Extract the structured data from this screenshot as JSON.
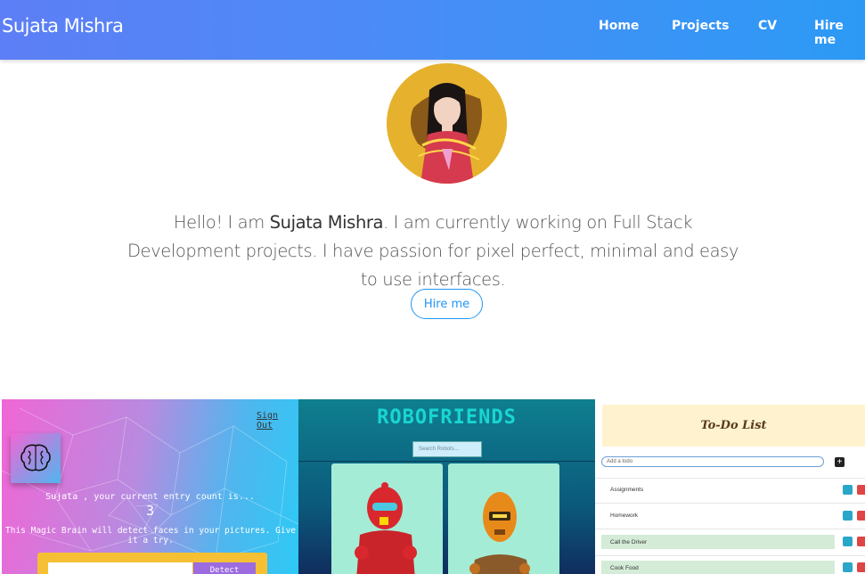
{
  "navbar": {
    "brand": "Sujata Mishra",
    "links": [
      "Home",
      "Projects",
      "CV",
      "Hire me"
    ]
  },
  "hero": {
    "greeting": "Hello! I am ",
    "name": "Sujata Mishra",
    "intro_rest": ". I am currently working on Full Stack Development projects. I have passion for pixel perfect, minimal and easy to use interfaces.",
    "hire_button": "Hire me"
  },
  "projects": {
    "face_detect": {
      "sign_out": "Sign Out",
      "count_text": "Sujata , your current entry count is...",
      "count": "3",
      "magic_text": "This Magic Brain will detect faces in your pictures. Give it a try.",
      "detect_button": "Detect"
    },
    "robofriends": {
      "title": "ROBOFRIENDS",
      "search_placeholder": "Search Robots..."
    },
    "todo": {
      "title": "To-Do List",
      "input_placeholder": "Add a todo",
      "add_icon": "+",
      "items": [
        "Assignments",
        "Homework",
        "Call the Driver",
        "Cook Food"
      ]
    }
  },
  "colors": {
    "nav_gradient_start": "#5d7ef6",
    "nav_gradient_end": "#2c9af5",
    "accent": "#2196f3"
  }
}
